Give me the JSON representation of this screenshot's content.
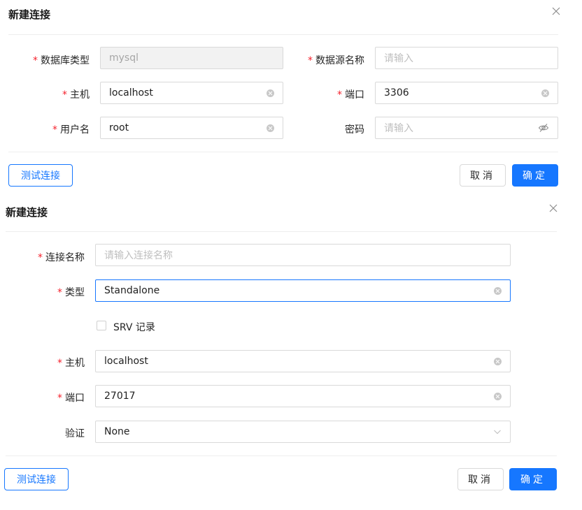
{
  "dialog1": {
    "title": "新建连接",
    "fields": {
      "db_type": {
        "label": "数据库类型",
        "value": "mysql"
      },
      "datasource_name": {
        "label": "数据源名称",
        "placeholder": "请输入"
      },
      "host": {
        "label": "主机",
        "value": "localhost"
      },
      "port": {
        "label": "端口",
        "value": "3306"
      },
      "username": {
        "label": "用户名",
        "value": "root"
      },
      "password": {
        "label": "密码",
        "placeholder": "请输入"
      }
    },
    "buttons": {
      "test": "测试连接",
      "cancel": "取消",
      "confirm": "确定"
    }
  },
  "dialog2": {
    "title": "新建连接",
    "fields": {
      "conn_name": {
        "label": "连接名称",
        "placeholder": "请输入连接名称"
      },
      "type": {
        "label": "类型",
        "value": "Standalone"
      },
      "srv": {
        "label": "SRV 记录"
      },
      "host": {
        "label": "主机",
        "value": "localhost"
      },
      "port": {
        "label": "端口",
        "value": "27017"
      },
      "auth": {
        "label": "验证",
        "value": "None"
      }
    },
    "buttons": {
      "test": "测试连接",
      "cancel": "取消",
      "confirm": "确定"
    }
  },
  "icons": {
    "close": "close-icon",
    "clear": "clear-icon",
    "eye_off": "eye-off-icon",
    "chevron_down": "chevron-down-icon"
  },
  "colors": {
    "primary": "#1677ff",
    "required": "#f5222d",
    "disabled_bg": "#f2f2f2"
  }
}
